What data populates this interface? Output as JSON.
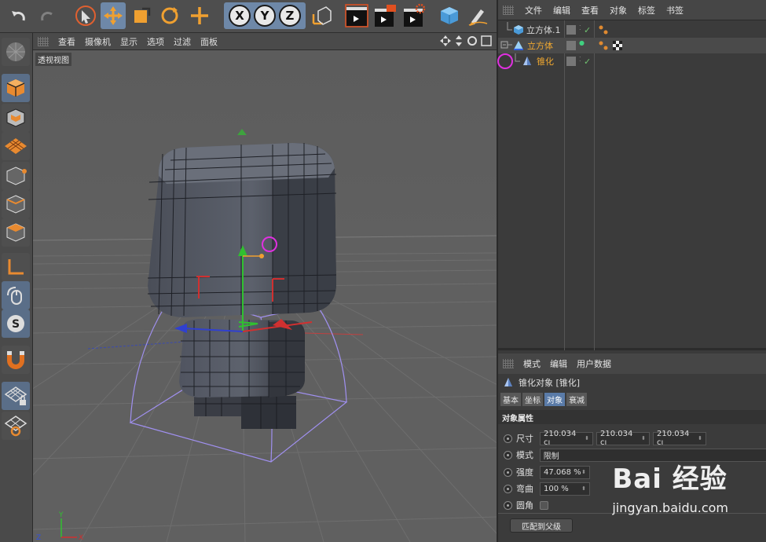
{
  "viewport": {
    "menu": [
      "查看",
      "摄像机",
      "显示",
      "选项",
      "过滤",
      "面板"
    ],
    "label": "透视视图"
  },
  "object_manager": {
    "menu": [
      "文件",
      "编辑",
      "查看",
      "对象",
      "标签",
      "书签"
    ],
    "objects": [
      {
        "name": "立方体.1",
        "color": "#d8d8d8"
      },
      {
        "name": "立方体",
        "color": "#f0a830"
      },
      {
        "name": "锥化",
        "color": "#f0a830"
      }
    ]
  },
  "attributes": {
    "menu": [
      "模式",
      "编辑",
      "用户数据"
    ],
    "title": "锥化对象 [锥化]",
    "tabs": [
      "基本",
      "坐标",
      "对象",
      "衰减"
    ],
    "active_tab": "对象",
    "section": "对象属性",
    "size_label": "尺寸",
    "size_values": [
      "210.034 cı",
      "210.034 cı",
      "210.034 cı"
    ],
    "mode_label": "模式",
    "mode_value": "限制",
    "strength_label": "强度",
    "strength_value": "47.068 %",
    "curvature_label": "弯曲",
    "curvature_value": "100 %",
    "fillet_label": "圆角",
    "match_button": "匹配到父级"
  },
  "watermark": {
    "brand": "Bai 经验",
    "url": "jingyan.baidu.com"
  },
  "colors": {
    "accent": "#f0a030",
    "selection": "#5a7ba8",
    "highlight_circle": "#e030e0"
  }
}
